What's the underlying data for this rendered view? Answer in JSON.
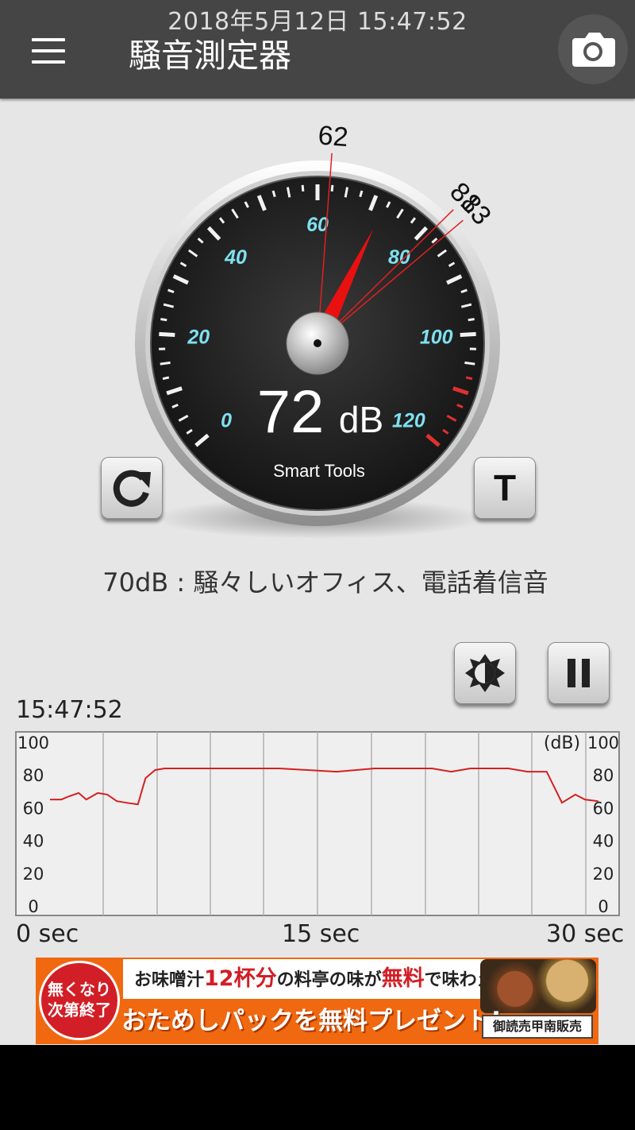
{
  "status_bar": {
    "datetime": "2018年5月12日 15:47:52"
  },
  "toolbar": {
    "title": "騒音測定器",
    "menu_icon": "hamburger-menu-icon",
    "camera_icon": "camera-icon"
  },
  "gauge": {
    "reading_value": "72",
    "reading_unit": "dB",
    "brand": "Smart Tools",
    "scale_labels": [
      "0",
      "20",
      "40",
      "60",
      "80",
      "100",
      "120"
    ],
    "needle_value": 72,
    "marker_values": [
      62,
      81,
      83
    ],
    "marker_labels": [
      "62",
      "81",
      "83"
    ],
    "reset_icon": "refresh-icon",
    "t_button_label": "T",
    "accent_color": "#7fe0f0",
    "needle_color": "#e81010"
  },
  "info": {
    "text": "70dB : 騒々しいオフィス、電話着信音"
  },
  "controls": {
    "brightness_icon": "brightness-icon",
    "pause_icon": "pause-icon"
  },
  "graph": {
    "timestamp": "15:47:52",
    "unit_label": "(dB)",
    "y_labels": [
      "100",
      "80",
      "60",
      "40",
      "20",
      "0"
    ],
    "x_labels": [
      "0 sec",
      "15 sec",
      "30 sec"
    ],
    "line_color": "#d42020",
    "chart_data": {
      "type": "line",
      "x": [
        0.0,
        0.6,
        1.0,
        1.5,
        1.9,
        2.5,
        3.0,
        3.5,
        4.0,
        4.6,
        5.0,
        5.5,
        6.0,
        6.7,
        7.2,
        7.8,
        8.5,
        9.8,
        12.0,
        15.0,
        17.0,
        18.0,
        20.0,
        21.0,
        22.0,
        24.0,
        25.0,
        26.0,
        26.8,
        27.5,
        28.0,
        28.7
      ],
      "values": [
        65,
        65,
        67,
        69,
        65,
        69,
        68,
        64,
        63,
        62,
        78,
        83,
        84,
        84,
        84,
        84,
        84,
        84,
        84,
        82,
        84,
        84,
        84,
        82,
        84,
        84,
        82,
        82,
        63,
        68,
        65,
        64
      ],
      "xlim": [
        0,
        30
      ],
      "ylim": [
        0,
        100
      ],
      "xlabel": "",
      "ylabel": "(dB)",
      "grid": true
    }
  },
  "ad": {
    "badge": "無くなり次第終了",
    "line1_a": "お味噌汁",
    "line1_b": "12杯分",
    "line1_c": "の料亭の味が",
    "line1_d": "無料",
    "line1_e": "で味わえる！",
    "line2": "おためしパックを無料プレゼント!",
    "sponsor": "御読売甲南販売"
  }
}
